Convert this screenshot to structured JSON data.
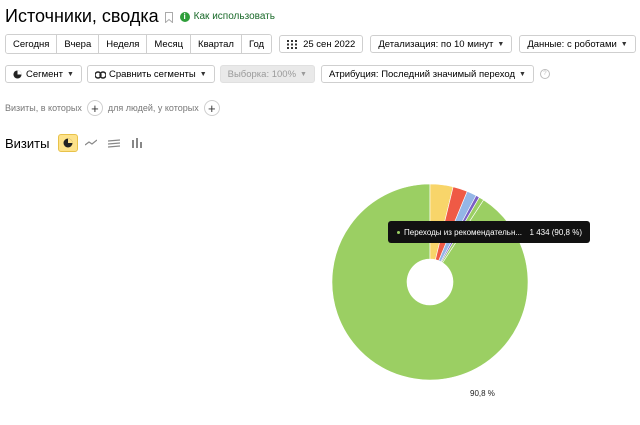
{
  "header": {
    "title": "Источники, сводка",
    "help_link": "Как использовать",
    "help_icon": "info-circle-icon"
  },
  "toolbar": {
    "periods": [
      "Сегодня",
      "Вчера",
      "Неделя",
      "Месяц",
      "Квартал",
      "Год"
    ],
    "date": "25 сен 2022",
    "detail": "Детализация: по 10 минут",
    "data": "Данные: с роботами"
  },
  "segments": {
    "segment": "Сегмент",
    "compare": "Сравнить сегменты",
    "sample": "Выборка: 100%",
    "attribution": "Атрибуция: Последний значимый переход"
  },
  "filters": {
    "visits_where": "Визиты, в которых",
    "people_where": "для людей, у которых"
  },
  "chart_header": {
    "label": "Визиты"
  },
  "tooltip": {
    "label": "Переходы из рекомендательн...",
    "value": "1 434 (90,8 %)"
  },
  "chart_data": {
    "type": "pie",
    "slices": [
      {
        "value": 90.8,
        "color": "#9bcf63"
      },
      {
        "value": 3.8,
        "color": "#f8d56a"
      },
      {
        "value": 2.4,
        "color": "#ef5a45"
      },
      {
        "value": 1.6,
        "color": "#94b6e6"
      },
      {
        "value": 0.6,
        "color": "#7b5fc4"
      },
      {
        "value": 0.8,
        "color": "#9bcf63"
      }
    ],
    "data_labels": [
      "90,8 %"
    ]
  }
}
